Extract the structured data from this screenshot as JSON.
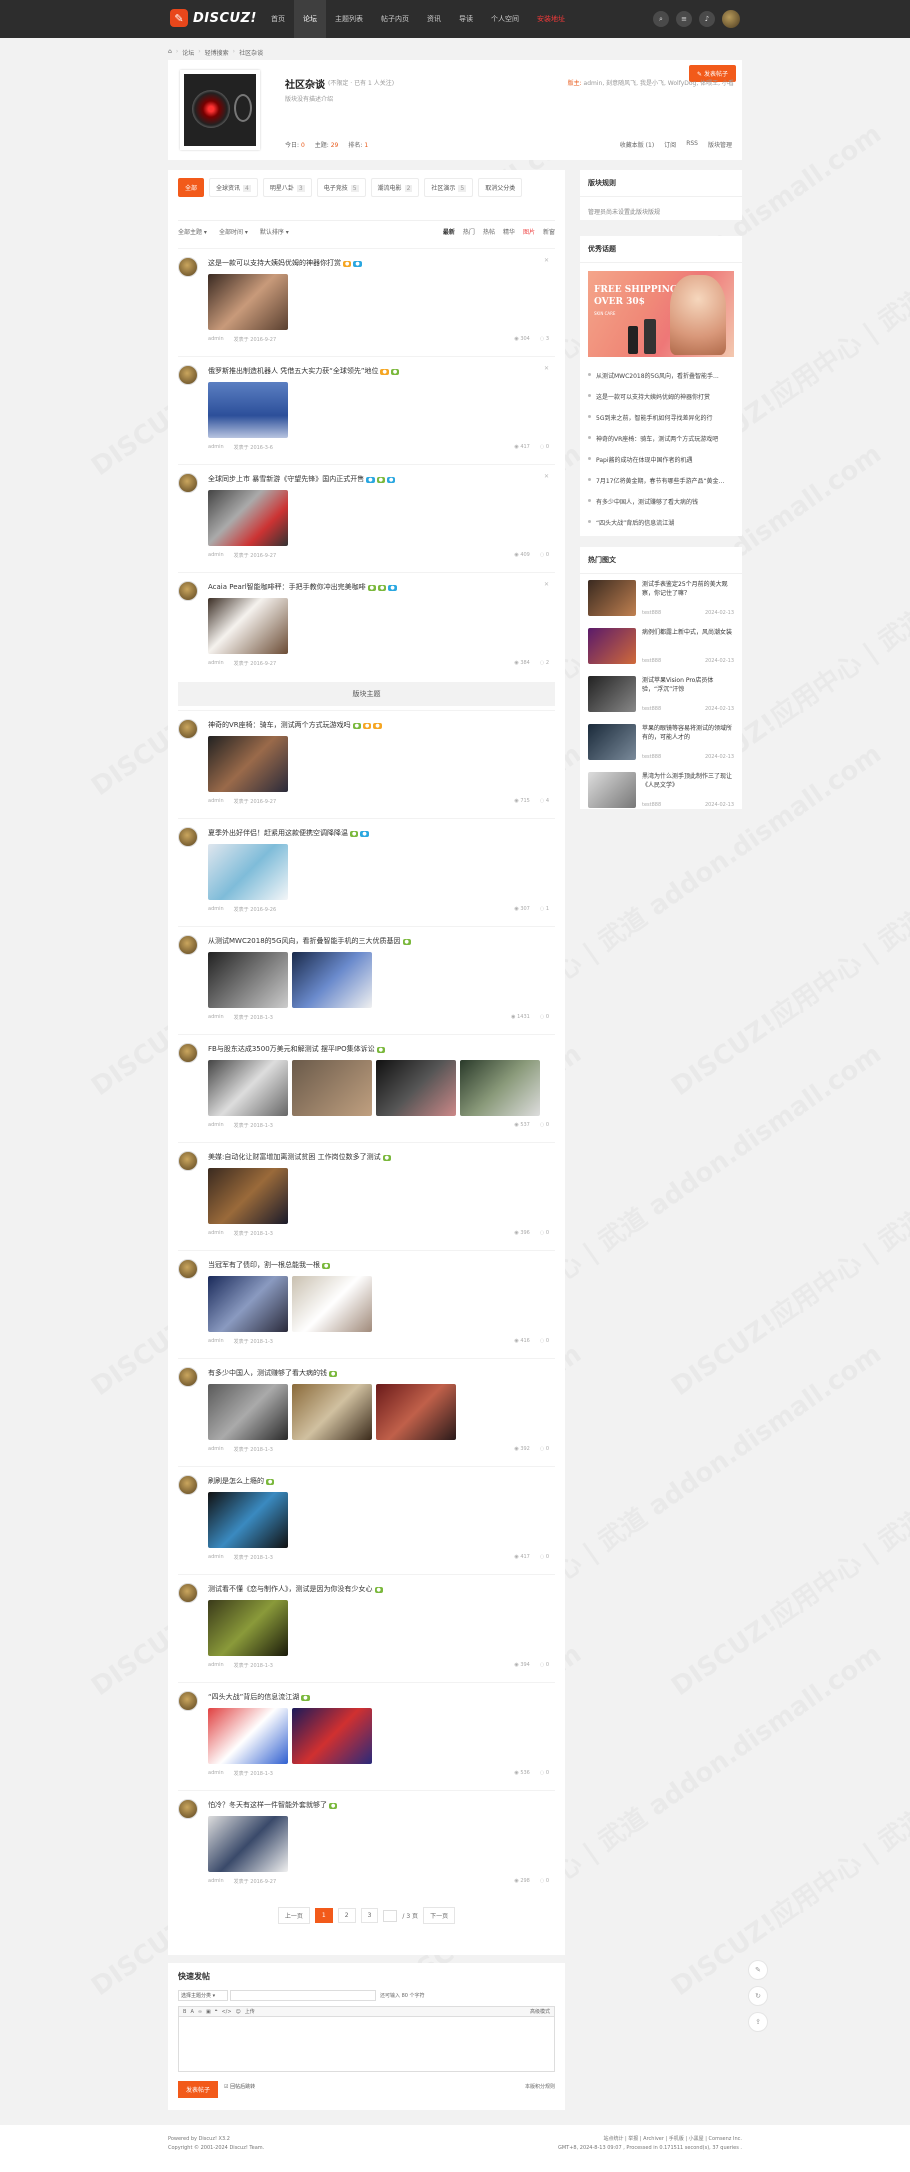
{
  "header": {
    "logo_text": "DISCUZ!",
    "nav": [
      "首页",
      "论坛",
      "主题列表",
      "帖子内页",
      "资讯",
      "导读",
      "个人空间",
      "安装地址"
    ]
  },
  "breadcrumb": [
    "论坛",
    "轻博搜索",
    "社区杂谈"
  ],
  "forum": {
    "name": "社区杂谈",
    "stats": "(不限定 · 已有 1 人关注)",
    "mods_label": "版主:",
    "mods": "admin, 刻意随风飞, 我是小飞, WolfyDog, 体喂王, 小看",
    "desc": "版块没有描述介绍",
    "today_label": "今日:",
    "today": "0",
    "topics_label": "主题:",
    "topics": "29",
    "rank_label": "排名:",
    "rank": "1",
    "post_button": "发表帖子",
    "actions": [
      "收藏本版 (1)",
      "订阅",
      "RSS",
      "版块管理"
    ]
  },
  "tabs": [
    {
      "label": "全部",
      "count": ""
    },
    {
      "label": "全球资讯",
      "count": "4"
    },
    {
      "label": "明星八卦",
      "count": "3"
    },
    {
      "label": "电子竞技",
      "count": "5"
    },
    {
      "label": "潮流电影",
      "count": "2"
    },
    {
      "label": "社区演示",
      "count": "5"
    },
    {
      "label": "取消父分类",
      "count": ""
    }
  ],
  "filters": {
    "left": [
      "全部主题",
      "全部时间",
      "默认排序"
    ],
    "right": [
      "最新",
      "热门",
      "热帖",
      "精华",
      "图片",
      "新窗"
    ]
  },
  "posts": [
    {
      "title": "这是一款可以支持大姨妈优姆的神器你打赏",
      "date": "发表于 2016-9-27",
      "views": "304",
      "replies": "3",
      "author": "admin"
    },
    {
      "title": "俄罗斯推出制造机器人 凭借五大实力获“全球领先”地位",
      "date": "发表于 2016-3-6",
      "views": "417",
      "replies": "0",
      "author": "admin"
    },
    {
      "title": "全球同步上市 暴雪新游《守望先锋》国内正式开售",
      "date": "发表于 2016-9-27",
      "views": "409",
      "replies": "0",
      "author": "admin"
    },
    {
      "title": "Acaia Pearl智能咖啡秤：手把手教你冲出完美咖啡",
      "date": "发表于 2016-9-27",
      "views": "384",
      "replies": "2",
      "author": "admin"
    },
    {
      "title": "神奇的VR座椅：骑车，测试两个方式玩游戏吗",
      "date": "发表于 2016-9-27",
      "views": "715",
      "replies": "4",
      "author": "admin"
    },
    {
      "title": "夏季外出好伴侣！赶紧用这款便携空调降降温",
      "date": "发表于 2016-9-26",
      "views": "307",
      "replies": "1",
      "author": "admin"
    },
    {
      "title": "从测试MWC2018的5G风向，看折叠智能手机的三大优质基因",
      "date": "发表于 2018-1-3",
      "views": "1431",
      "replies": "0",
      "author": "admin"
    },
    {
      "title": "FB与股东达成3500万美元和解测试 摆平IPO集体诉讼",
      "date": "发表于 2018-1-3",
      "views": "537",
      "replies": "0",
      "author": "admin"
    },
    {
      "title": "美媒:自动化让财富增加离测试贫困 工作岗位数多了测试",
      "date": "发表于 2018-1-3",
      "views": "396",
      "replies": "0",
      "author": "admin"
    },
    {
      "title": "当冠军有了债印，割一根总能我一根",
      "date": "发表于 2018-1-3",
      "views": "416",
      "replies": "0",
      "author": "admin"
    },
    {
      "title": "有多少中国人，测试赚够了看大病的钱",
      "date": "发表于 2018-1-3",
      "views": "392",
      "replies": "0",
      "author": "admin"
    },
    {
      "title": "刷刷是怎么上瘾的",
      "date": "发表于 2018-1-3",
      "views": "417",
      "replies": "0",
      "author": "admin"
    },
    {
      "title": "测试看不懂《恋与制作人》，测试是因为你没有少女心",
      "date": "发表于 2018-1-3",
      "views": "394",
      "replies": "0",
      "author": "admin"
    },
    {
      "title": "“四头大战”背后的信息流江湖",
      "date": "发表于 2018-1-3",
      "views": "536",
      "replies": "0",
      "author": "admin"
    },
    {
      "title": "怕冷？冬天有这样一件智能外套就够了",
      "date": "发表于 2016-9-27",
      "views": "298",
      "replies": "0",
      "author": "admin"
    }
  ],
  "divider_label": "版块主题",
  "pager": {
    "prev": "上一页",
    "pages": [
      "1",
      "2",
      "3"
    ],
    "total": "/ 3 页",
    "next": "下一页"
  },
  "sidebar": {
    "rules_title": "版块规则",
    "rules_text": "管理员尚未设置此版块版规",
    "rec_title": "优秀话题",
    "banner_line1": "FREE SHIPPING",
    "banner_line2": "OVER 30$",
    "banner_line3": "SKIN CARE",
    "rec_items": [
      "从测试MWC2018的5G风向，看折叠智能手...",
      "这是一款可以支持大姨妈优姆的神器你打赏",
      "5G到来之前，智能手机如何寻找差异化的行",
      "神奇的VR座椅：骑车，测试两个方式玩游戏吧",
      "Papi酱的成功在体现中国作者的机遇",
      "7月17亿将黄金期，春节有哪些手游产品“黄金...",
      "有多少中国人，测试赚够了看大病的钱",
      "“四头大战”背后的信息流江湖"
    ],
    "hot_title": "热门图文",
    "hot_items": [
      {
        "title": "测试手表鉴定25个月前的美大观察，你记住了嘛？",
        "author": "test888",
        "date": "2024-02-13"
      },
      {
        "title": "病例们都露上新中式，风尚潮女装",
        "author": "test888",
        "date": "2024-02-13"
      },
      {
        "title": "测试苹果Vision Pro店员体验，“浮沉”汗惊",
        "author": "test888",
        "date": "2024-02-13"
      },
      {
        "title": "苹果的眼镜等容易将测试的领域所有的，可能人才的",
        "author": "test888",
        "date": "2024-02-13"
      },
      {
        "title": "黑湾为什么测手顶此制作三了现让《人民文学》",
        "author": "test888",
        "date": "2024-02-13"
      }
    ]
  },
  "fast": {
    "title": "快速发帖",
    "select": "选择主题分类",
    "hint": "还可输入 80 个字符",
    "toolbar_upload": "上传",
    "toolbar_adv": "高级模式",
    "submit": "发表帖子",
    "check": "回帖后跳转",
    "rule": "本版积分规则"
  },
  "footer": {
    "powered": "Powered by Discuz! X3.2",
    "copyright": "Copyright © 2001-2024 Discuz! Team.",
    "links": "站点统计 | 举报 | Archiver | 手机版 | 小黑屋 | Comsenz Inc.",
    "time": "GMT+8, 2024-8-13 09:07 , Processed in 0.171511 second(s), 37 queries ."
  },
  "watermark": "DISCUZ!应用中心 | 武道 addon.dismall.com"
}
